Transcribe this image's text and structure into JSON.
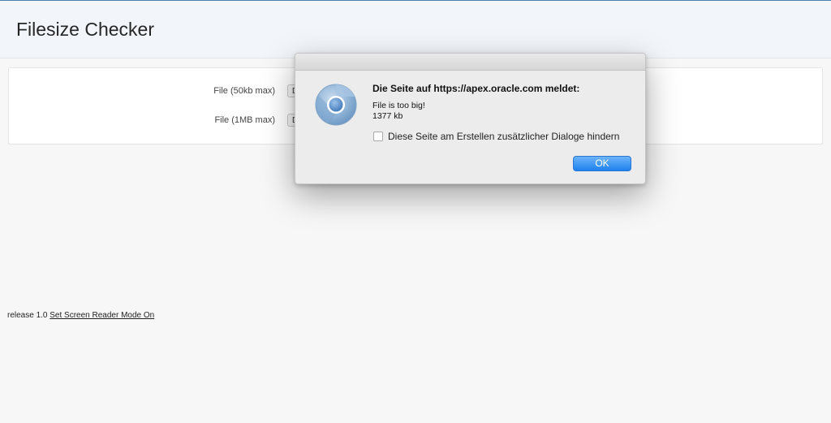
{
  "app": {
    "title": "Filesize Checker"
  },
  "form": {
    "fields": [
      {
        "label": "File (50kb max)",
        "button_text": "D"
      },
      {
        "label": "File (1MB max)",
        "button_text": "D"
      }
    ]
  },
  "footer": {
    "release": "release 1.0",
    "screen_reader_link": "Set Screen Reader Mode On"
  },
  "dialog": {
    "heading": "Die Seite auf https://apex.oracle.com meldet:",
    "message_line1": "File is too big!",
    "message_line2": "1377 kb",
    "checkbox_label": "Diese Seite am Erstellen zusätzlicher Dialoge hindern",
    "checkbox_checked": false,
    "ok_label": "OK",
    "icon": "chrome-icon"
  },
  "colors": {
    "header_bg": "#f2f6fb",
    "ok_button": "#1e82ef"
  }
}
